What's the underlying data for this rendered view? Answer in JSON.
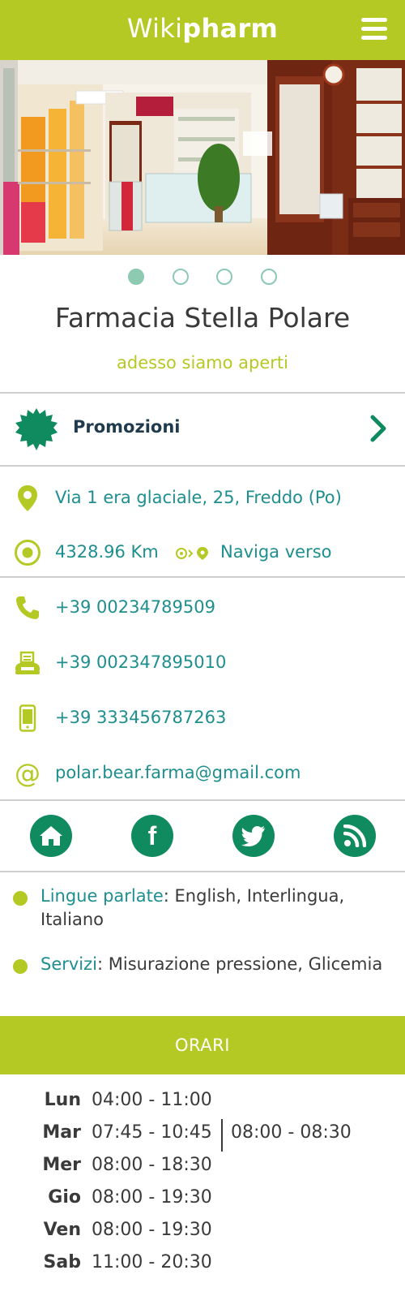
{
  "header": {
    "logo_light": "Wiki",
    "logo_bold": "pharm",
    "menu_icon": "hamburger-menu-icon"
  },
  "hero": {
    "slide_count": 4,
    "active_slide": 1
  },
  "pharmacy": {
    "name": "Farmacia Stella Polare",
    "status": "adesso siamo aperti"
  },
  "promo": {
    "label": "Promozioni",
    "icon": "starburst-badge-icon",
    "chevron": "chevron-right-icon"
  },
  "location": {
    "address": "Via 1 era glaciale, 25, Freddo (Po)",
    "distance": "4328.96 Km",
    "navigate_label": "Naviga verso"
  },
  "contacts": {
    "phone": "+39 00234789509",
    "fax": "+39 002347895010",
    "mobile": "+39 333456787263",
    "email": "polar.bear.farma@gmail.com"
  },
  "social": {
    "items": [
      "home-icon",
      "facebook-icon",
      "twitter-icon",
      "rss-icon"
    ]
  },
  "details": {
    "languages_label": "Lingue parlate",
    "languages_value": ": English, Interlingua, Italiano",
    "services_label": "Servizi",
    "services_value": ": Misurazione pressione, Glicemia"
  },
  "hours": {
    "title": "ORARI",
    "rows": [
      {
        "day": "Lun",
        "slot1": "04:00 - 11:00",
        "slot2": ""
      },
      {
        "day": "Mar",
        "slot1": "07:45 - 10:45",
        "slot2": "08:00 - 08:30"
      },
      {
        "day": "Mer",
        "slot1": "08:00 - 18:30",
        "slot2": ""
      },
      {
        "day": "Gio",
        "slot1": "08:00 - 19:30",
        "slot2": ""
      },
      {
        "day": "Ven",
        "slot1": "08:00 - 19:30",
        "slot2": ""
      },
      {
        "day": "Sab",
        "slot1": "11:00 - 20:30",
        "slot2": ""
      }
    ]
  },
  "colors": {
    "brand_green": "#b5c924",
    "teal_text": "#1e8e8e",
    "social_green": "#0f8b5f",
    "dot_color": "#8ccab2",
    "promo_text": "#1f3b4d"
  }
}
